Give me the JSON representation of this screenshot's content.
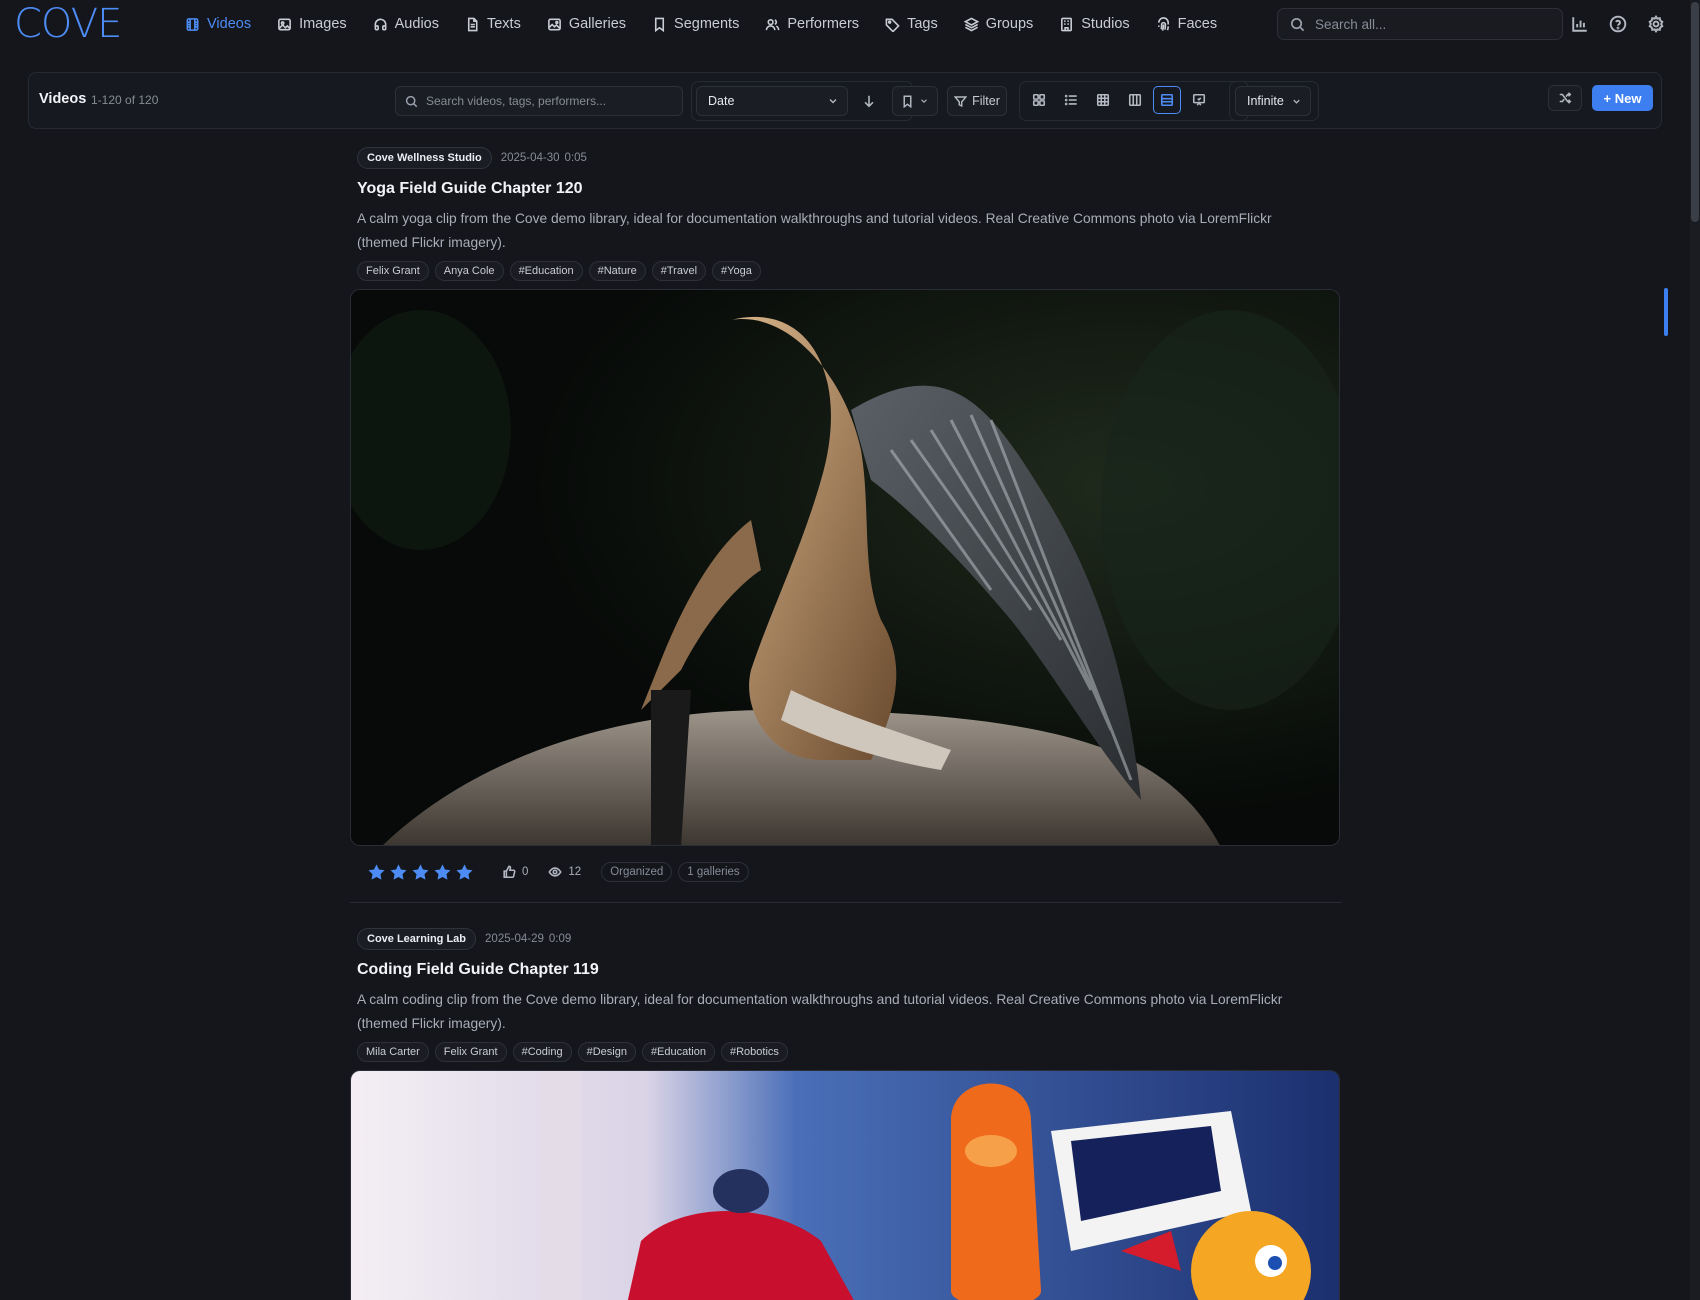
{
  "app": {
    "logo": "COVE",
    "accent": "#4d8cf5"
  },
  "nav": {
    "items": [
      {
        "label": "Videos",
        "icon": "film-icon",
        "active": true
      },
      {
        "label": "Images",
        "icon": "image-icon"
      },
      {
        "label": "Audios",
        "icon": "headphones-icon"
      },
      {
        "label": "Texts",
        "icon": "document-icon"
      },
      {
        "label": "Galleries",
        "icon": "gallery-icon"
      },
      {
        "label": "Segments",
        "icon": "bookmark-icon"
      },
      {
        "label": "Performers",
        "icon": "users-icon"
      },
      {
        "label": "Tags",
        "icon": "tag-icon"
      },
      {
        "label": "Groups",
        "icon": "layers-icon"
      },
      {
        "label": "Studios",
        "icon": "building-icon"
      },
      {
        "label": "Faces",
        "icon": "fingerprint-icon"
      }
    ],
    "search_placeholder": "Search all..."
  },
  "toolbar": {
    "title": "Videos",
    "count": "1-120 of 120",
    "search_placeholder": "Search videos, tags, performers...",
    "sort_value": "Date",
    "filter_label": "Filter",
    "pagination_value": "Infinite",
    "new_label": "+ New"
  },
  "videos": [
    {
      "studio": "Cove Wellness Studio",
      "date": "2025-04-30",
      "duration": "0:05",
      "title": "Yoga Field Guide Chapter 120",
      "description": "A calm yoga clip from the Cove demo library, ideal for documentation walkthroughs and tutorial videos. Real Creative Commons photo via LoremFlickr (themed Flickr imagery).",
      "tags": [
        "Felix Grant",
        "Anya Cole",
        "#Education",
        "#Nature",
        "#Travel",
        "#Yoga"
      ],
      "rating": 5,
      "likes": "0",
      "views": "12",
      "status": "Organized",
      "galleries": "1 galleries"
    },
    {
      "studio": "Cove Learning Lab",
      "date": "2025-04-29",
      "duration": "0:09",
      "title": "Coding Field Guide Chapter 119",
      "description": "A calm coding clip from the Cove demo library, ideal for documentation walkthroughs and tutorial videos. Real Creative Commons photo via LoremFlickr (themed Flickr imagery).",
      "tags": [
        "Mila Carter",
        "Felix Grant",
        "#Coding",
        "#Design",
        "#Education",
        "#Robotics"
      ]
    }
  ]
}
